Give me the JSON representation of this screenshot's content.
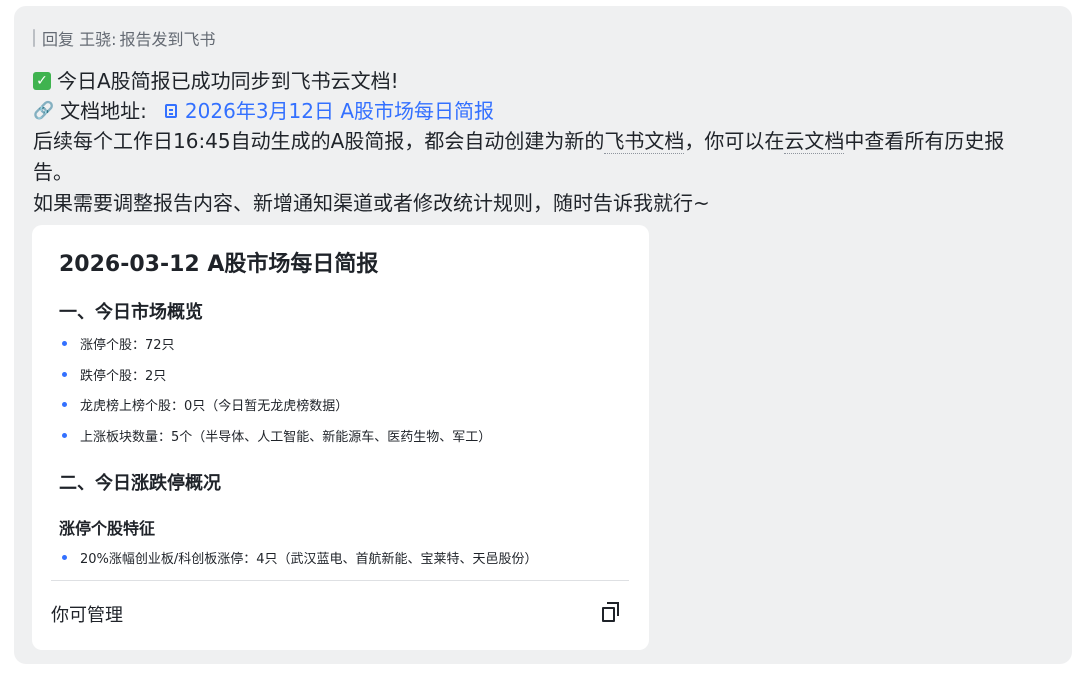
{
  "reply": {
    "prefix": "回复 王骁:",
    "text": "报告发到飞书"
  },
  "message": {
    "success_icon": "check-icon",
    "success_text": "今日A股简报已成功同步到飞书云文档!",
    "doc_label_icon": "link-icon",
    "doc_label": "文档地址:",
    "doc_icon": "doc-icon",
    "doc_link": "2026年3月12日 A股市场每日简报",
    "para1_a": "后续每个工作日16:45自动生成的A股简报，都会自动创建为新的",
    "para1_b": "飞书文档",
    "para1_c": "，你可以在",
    "para1_d": "云文档",
    "para1_e": "中查看所有历史报告。",
    "para2": "如果需要调整报告内容、新增通知渠道或者修改统计规则，随时告诉我就行~"
  },
  "card": {
    "title": "2026-03-12 A股市场每日简报",
    "section1": {
      "heading": "一、今日市场概览",
      "items": [
        "涨停个股：72只",
        "跌停个股：2只",
        "龙虎榜上榜个股：0只（今日暂无龙虎榜数据）",
        "上涨板块数量：5个（半导体、人工智能、新能源车、医药生物、军工）"
      ]
    },
    "section2": {
      "heading": "二、今日涨跌停概况",
      "subheading": "涨停个股特征",
      "items": [
        "20%涨幅创业板/科创板涨停：4只（武汉蓝电、首航新能、宝莱特、天邑股份）"
      ]
    },
    "footer_label": "你可管理",
    "footer_icon": "copy-icon"
  },
  "colors": {
    "bubble_bg": "#eff0f1",
    "link_blue": "#3370ff",
    "check_green": "#3fb34f"
  }
}
